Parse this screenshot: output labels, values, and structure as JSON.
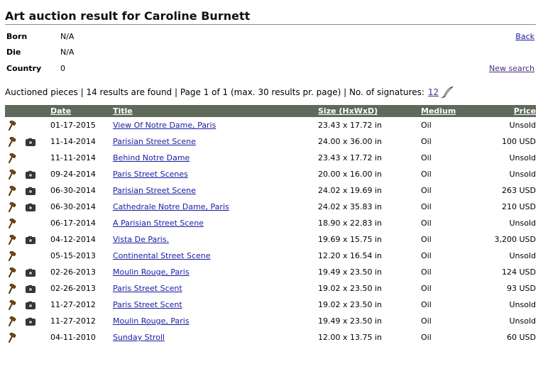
{
  "title": "Art auction result for Caroline Burnett",
  "artist_info": {
    "born_label": "Born",
    "born_value": "N/A",
    "die_label": "Die",
    "die_value": "N/A",
    "country_label": "Country",
    "country_value": "0"
  },
  "links": {
    "back": "Back",
    "new_search": "New search"
  },
  "summary": {
    "text": "Auctioned pieces | 14 results are found | Page 1 of 1 (max. 30 results pr. page) | No. of signatures:",
    "signatures": "12"
  },
  "columns": {
    "date": "Date",
    "title": "Title",
    "size": "Size (HxWxD)",
    "medium": "Medium",
    "price": "Price"
  },
  "rows": [
    {
      "date": "01-17-2015",
      "title": "View Of Notre Dame, Paris",
      "size": "23.43 x 17.72 in",
      "medium": "Oil",
      "price": "Unsold",
      "photo": false
    },
    {
      "date": "11-14-2014",
      "title": "Parisian Street Scene",
      "size": "24.00 x 36.00 in",
      "medium": "Oil",
      "price": "100 USD",
      "photo": true
    },
    {
      "date": "11-11-2014",
      "title": "Behind Notre Dame",
      "size": "23.43 x 17.72 in",
      "medium": "Oil",
      "price": "Unsold",
      "photo": false
    },
    {
      "date": "09-24-2014",
      "title": "Paris Street Scenes",
      "size": "20.00 x 16.00 in",
      "medium": "Oil",
      "price": "Unsold",
      "photo": true
    },
    {
      "date": "06-30-2014",
      "title": "Parisian Street Scene",
      "size": "24.02 x 19.69 in",
      "medium": "Oil",
      "price": "263 USD",
      "photo": true
    },
    {
      "date": "06-30-2014",
      "title": "Cathedrale Notre Dame, Paris",
      "size": "24.02 x 35.83 in",
      "medium": "Oil",
      "price": "210 USD",
      "photo": true
    },
    {
      "date": "06-17-2014",
      "title": "A Parisian Street Scene",
      "size": "18.90 x 22.83 in",
      "medium": "Oil",
      "price": "Unsold",
      "photo": false
    },
    {
      "date": "04-12-2014",
      "title": "Vista De Paris.",
      "size": "19.69 x 15.75 in",
      "medium": "Oil",
      "price": "3,200 USD",
      "photo": true
    },
    {
      "date": "05-15-2013",
      "title": "Continental Street Scene",
      "size": "12.20 x 16.54 in",
      "medium": "Oil",
      "price": "Unsold",
      "photo": false
    },
    {
      "date": "02-26-2013",
      "title": "Moulin Rouge, Paris",
      "size": "19.49 x 23.50 in",
      "medium": "Oil",
      "price": "124 USD",
      "photo": true
    },
    {
      "date": "02-26-2013",
      "title": "Paris Street Scent",
      "size": "19.02 x 23.50 in",
      "medium": "Oil",
      "price": "93 USD",
      "photo": true
    },
    {
      "date": "11-27-2012",
      "title": "Paris Street Scent",
      "size": "19.02 x 23.50 in",
      "medium": "Oil",
      "price": "Unsold",
      "photo": true
    },
    {
      "date": "11-27-2012",
      "title": "Moulin Rouge, Paris",
      "size": "19.49 x 23.50 in",
      "medium": "Oil",
      "price": "Unsold",
      "photo": true
    },
    {
      "date": "04-11-2010",
      "title": "Sunday Stroll",
      "size": "12.00 x 13.75 in",
      "medium": "Oil",
      "price": "60 USD",
      "photo": false
    }
  ],
  "icons": {
    "auction": "gavel-icon",
    "photo": "camera-icon",
    "signature": "quill-pen-icon"
  },
  "colors": {
    "header_bg": "#5e6a5a",
    "link": "#1a1aa6",
    "visited_link": "#4a2f80"
  }
}
